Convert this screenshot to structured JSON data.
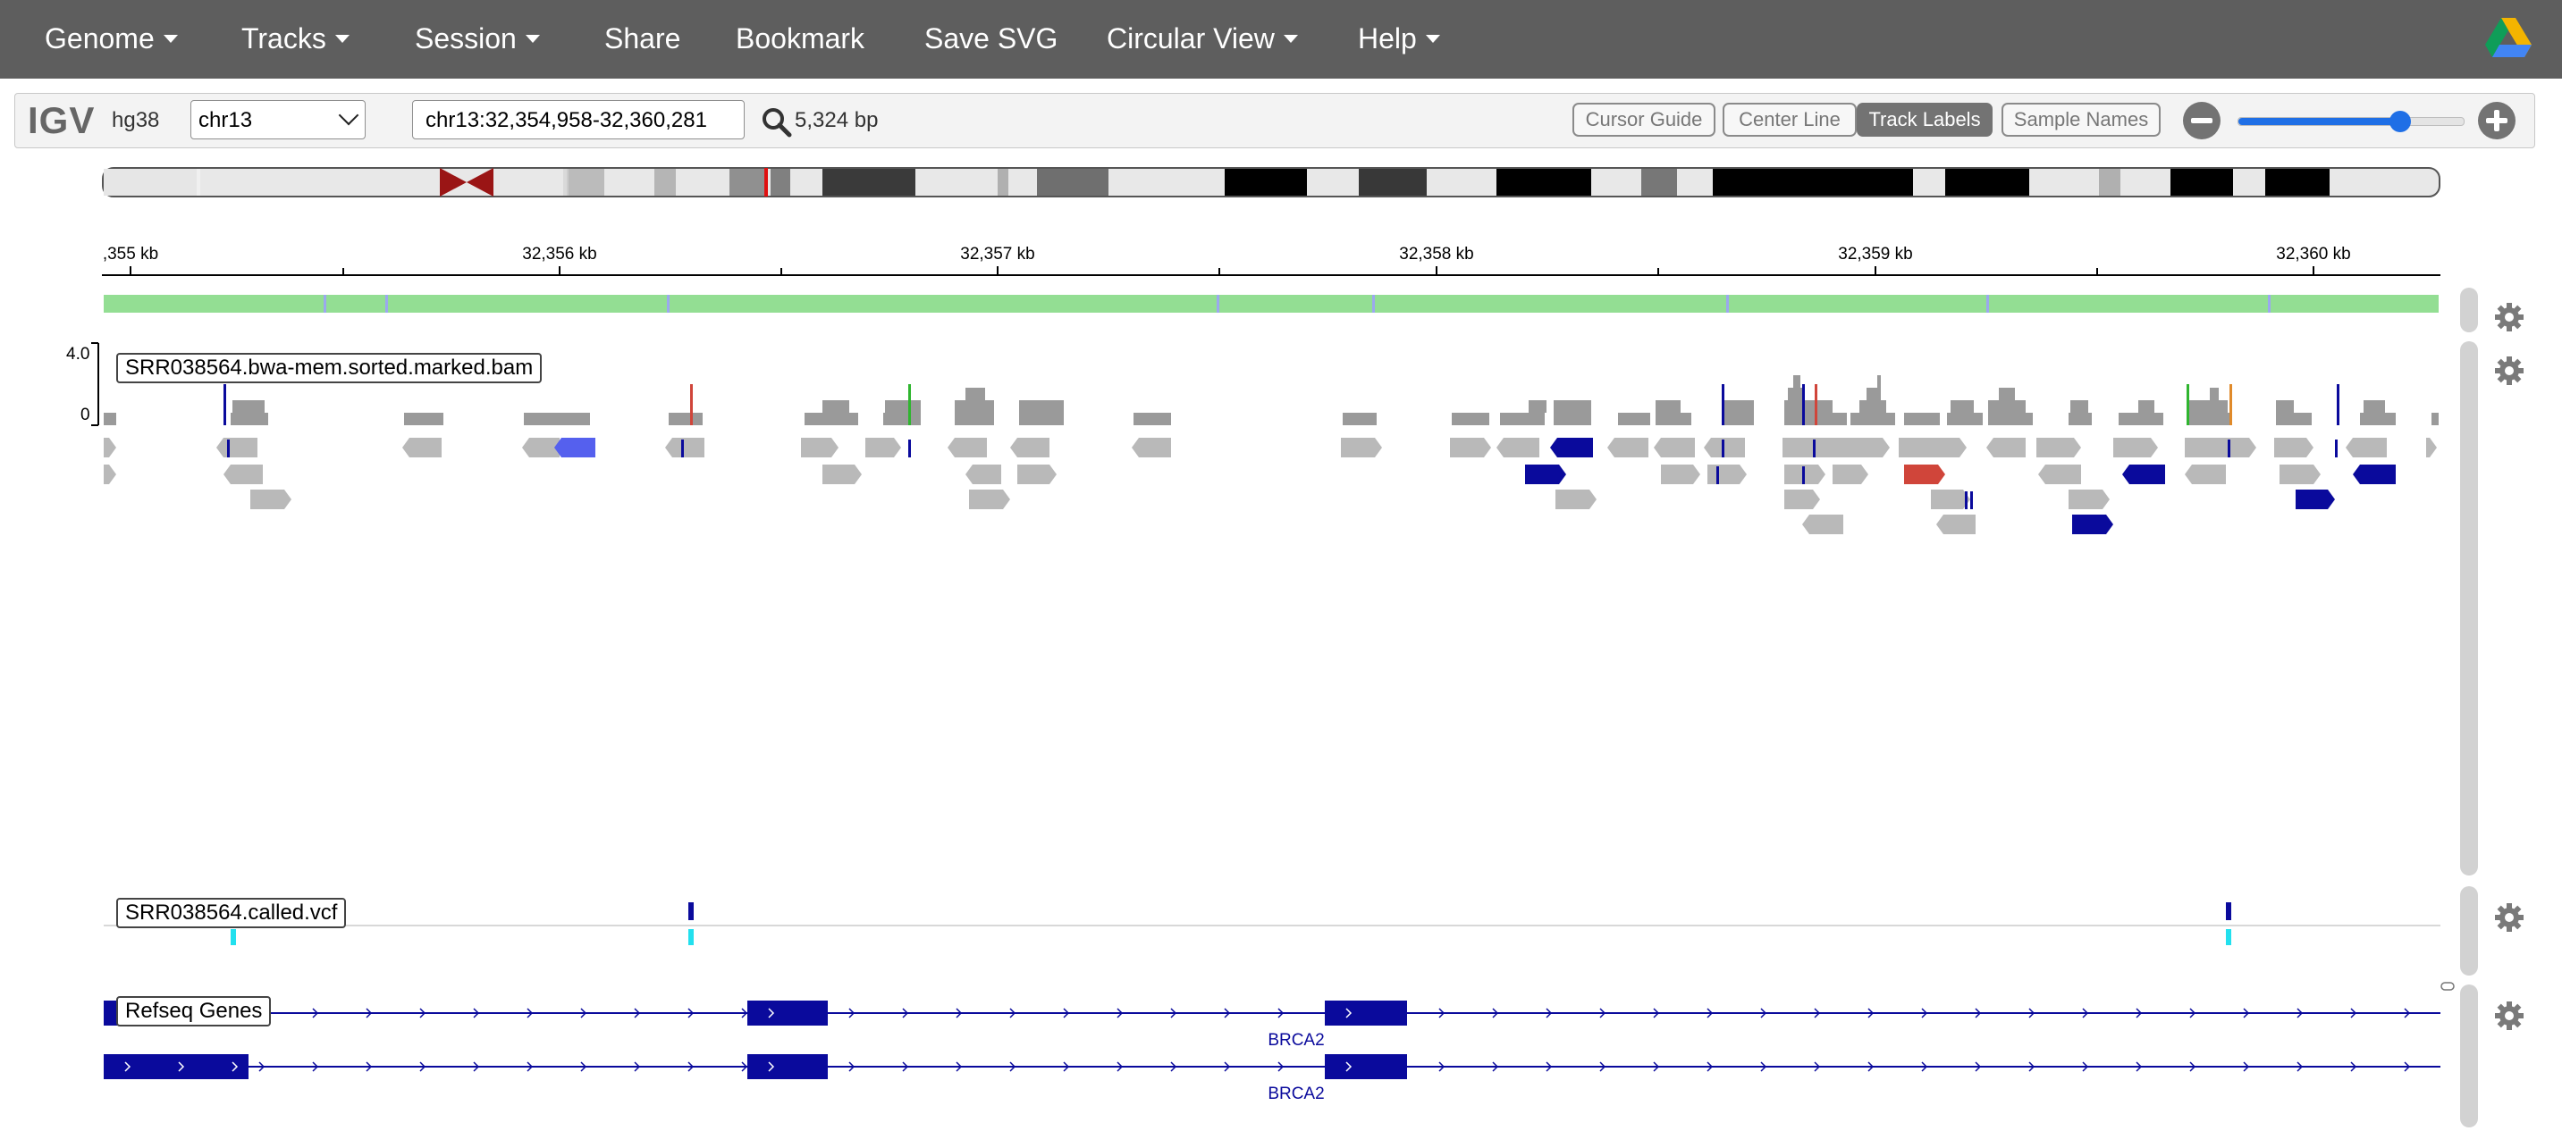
{
  "navbar": {
    "items": [
      {
        "label": "Genome",
        "dropdown": true
      },
      {
        "label": "Tracks",
        "dropdown": true
      },
      {
        "label": "Session",
        "dropdown": true
      },
      {
        "label": "Share",
        "dropdown": false
      },
      {
        "label": "Bookmark",
        "dropdown": false
      },
      {
        "label": "Save SVG",
        "dropdown": false
      },
      {
        "label": "Circular View",
        "dropdown": true
      },
      {
        "label": "Help",
        "dropdown": true
      }
    ],
    "right_icon": "google-drive-icon",
    "background": "#5e5e5e"
  },
  "header": {
    "logo": "IGV",
    "genome": "hg38",
    "chromosome": "chr13",
    "locus": "chr13:32,354,958-32,360,281",
    "search_icon": "search-icon",
    "bp_count": "5,324 bp",
    "buttons": [
      {
        "label": "Cursor Guide",
        "active": false
      },
      {
        "label": "Center Line",
        "active": false
      },
      {
        "label": "Track Labels",
        "active": true
      },
      {
        "label": "Sample Names",
        "active": false
      }
    ],
    "zoom": {
      "out_icon": "zoom-out-icon",
      "in_icon": "zoom-in-icon",
      "level": 0.72,
      "accent": "#1f6fe6"
    }
  },
  "ruler": {
    "labels": [
      ",355 kb",
      "32,356 kb",
      "32,357 kb",
      "32,358 kb",
      "32,359 kb",
      "32,360 kb"
    ]
  },
  "tracks": {
    "alignment": {
      "name": "SRR038564.bwa-mem.sorted.marked.bam",
      "scale_max": "4.0",
      "scale_min": "0",
      "colors": {
        "read": "#b9b9b9",
        "coverage": "#9a9a9a",
        "forward_strand_highlight": "#0a0a9c",
        "red_read": "#d0453a",
        "light_blue_read": "#5560ee"
      }
    },
    "variant": {
      "name": "SRR038564.called.vcf",
      "colors": {
        "site": "#0a0a9c",
        "genotype": "#22e0ee"
      }
    },
    "genes": {
      "name": "Refseq Genes",
      "transcripts": [
        {
          "gene": "BRCA2"
        },
        {
          "gene": "BRCA2"
        }
      ],
      "color": "#0a0a9c"
    }
  },
  "icons": {
    "track_settings": "gear-icon"
  }
}
